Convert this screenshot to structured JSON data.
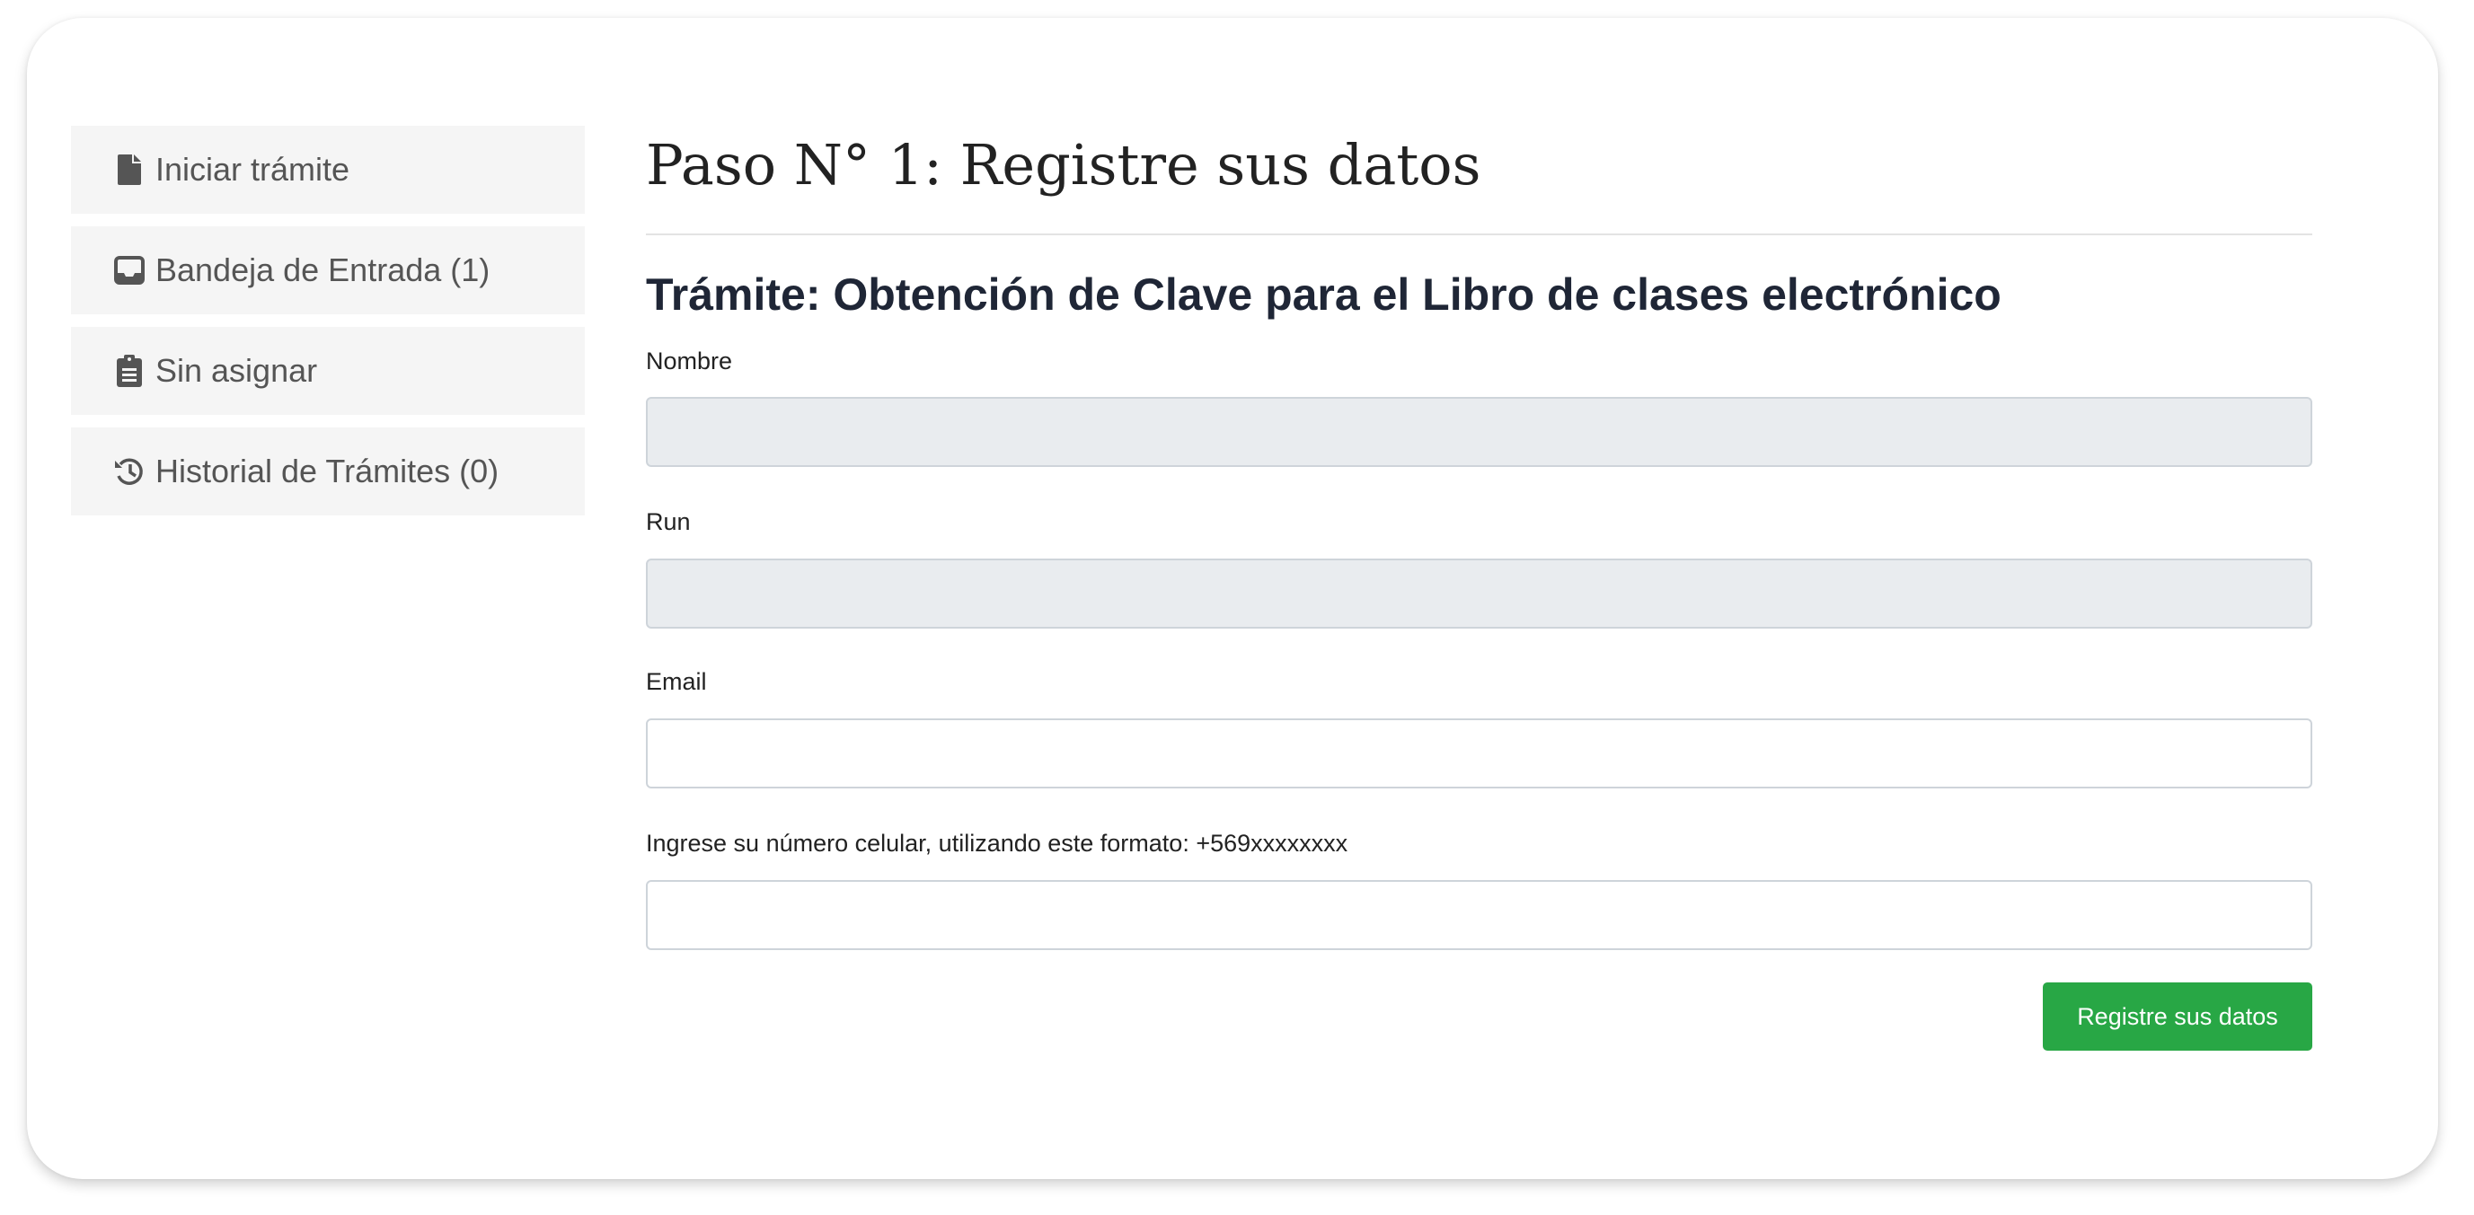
{
  "sidebar": {
    "items": [
      {
        "label": "Iniciar trámite",
        "icon": "file-icon"
      },
      {
        "label": "Bandeja de Entrada (1)",
        "icon": "inbox-icon"
      },
      {
        "label": "Sin asignar",
        "icon": "clipboard-icon"
      },
      {
        "label": "Historial de Trámites (0)",
        "icon": "history-icon"
      }
    ]
  },
  "main": {
    "title": "Paso N° 1: Registre sus datos",
    "subtitle": "Trámite: Obtención de Clave para el Libro de clases electrónico",
    "fields": {
      "nombre": {
        "label": "Nombre",
        "value": ""
      },
      "run": {
        "label": "Run",
        "value": ""
      },
      "email": {
        "label": "Email",
        "value": ""
      },
      "celular": {
        "label": "Ingrese su número celular, utilizando este formato: +569xxxxxxxx",
        "value": ""
      }
    },
    "submit_label": "Registre sus datos"
  },
  "colors": {
    "submit": "#28a745",
    "readonly_field": "#e9ecef",
    "sidebar_item_bg": "#f5f5f5"
  }
}
